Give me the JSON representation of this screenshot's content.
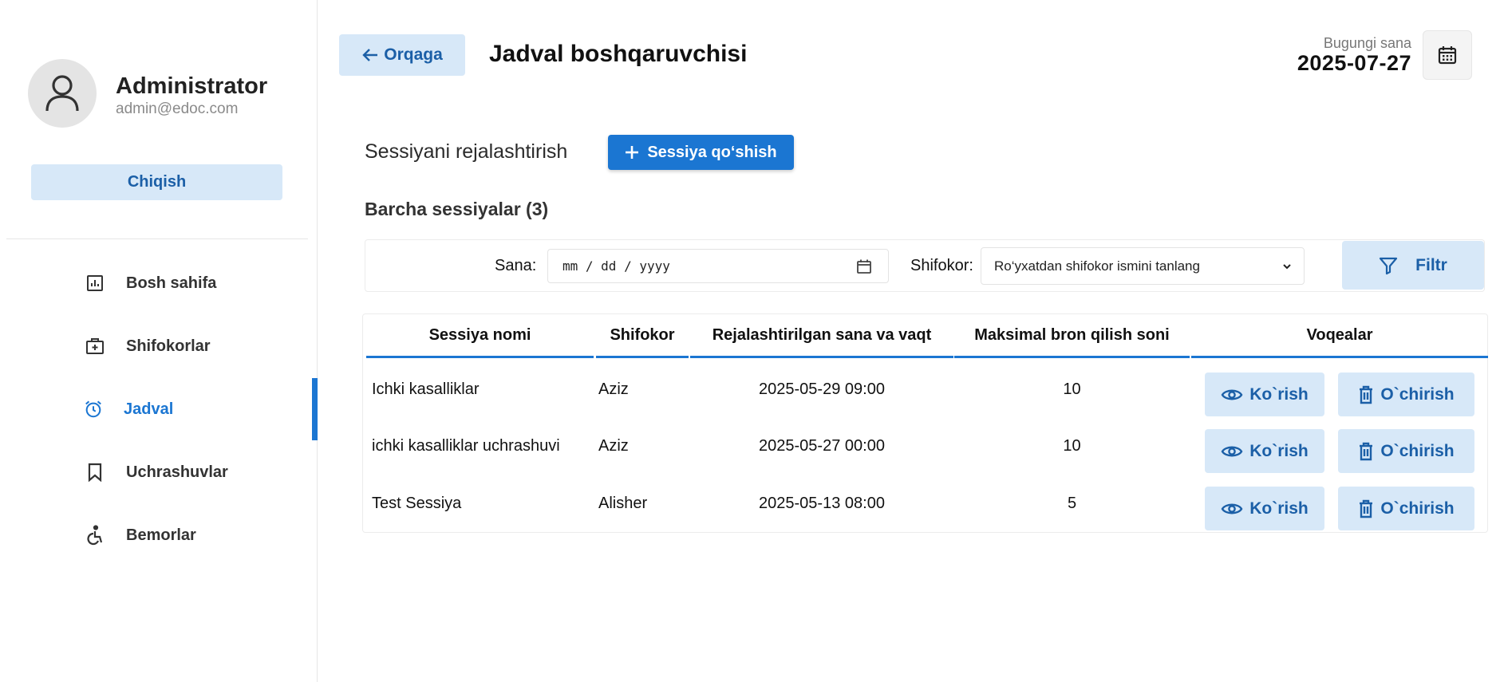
{
  "user": {
    "name": "Administrator",
    "email": "admin@edoc.com",
    "logout_label": "Chiqish"
  },
  "nav": {
    "items": [
      {
        "label": "Bosh sahifa",
        "icon": "dashboard-icon"
      },
      {
        "label": "Shifokorlar",
        "icon": "medical-kit-icon"
      },
      {
        "label": "Jadval",
        "icon": "alarm-clock-icon",
        "active": true
      },
      {
        "label": "Uchrashuvlar",
        "icon": "bookmark-icon"
      },
      {
        "label": "Bemorlar",
        "icon": "accessibility-icon"
      }
    ]
  },
  "header": {
    "back_label": "Orqaga",
    "title": "Jadval boshqaruvchisi",
    "date_caption": "Bugungi sana",
    "date_value": "2025-07-27"
  },
  "section": {
    "title": "Sessiyani rejalashtirish",
    "add_label": "Sessiya qo‘shish",
    "all_sessions": "Barcha sessiyalar (3)"
  },
  "filter": {
    "date_label": "Sana:",
    "date_placeholder": "mm / dd / yyyy",
    "doctor_label": "Shifokor:",
    "doctor_placeholder": "Ro‘yxatdan shifokor ismini tanlang",
    "button_label": "Filtr"
  },
  "table": {
    "headers": [
      "Sessiya nomi",
      "Shifokor",
      "Rejalashtirilgan sana va vaqt",
      "Maksimal bron qilish soni",
      "Voqealar"
    ],
    "view_label": "Ko`rish",
    "delete_label": "O`chirish",
    "rows": [
      {
        "name": "Ichki kasalliklar",
        "doctor": "Aziz",
        "datetime": "2025-05-29 09:00",
        "max": "10"
      },
      {
        "name": "ichki kasalliklar uchrashuvi",
        "doctor": "Aziz",
        "datetime": "2025-05-27 00:00",
        "max": "10"
      },
      {
        "name": "Test Sessiya",
        "doctor": "Alisher",
        "datetime": "2025-05-13 08:00",
        "max": "5"
      }
    ]
  },
  "colors": {
    "accent": "#1b76d2",
    "light_button": "#d7e8f8",
    "light_button_text": "#1b5fa7"
  }
}
